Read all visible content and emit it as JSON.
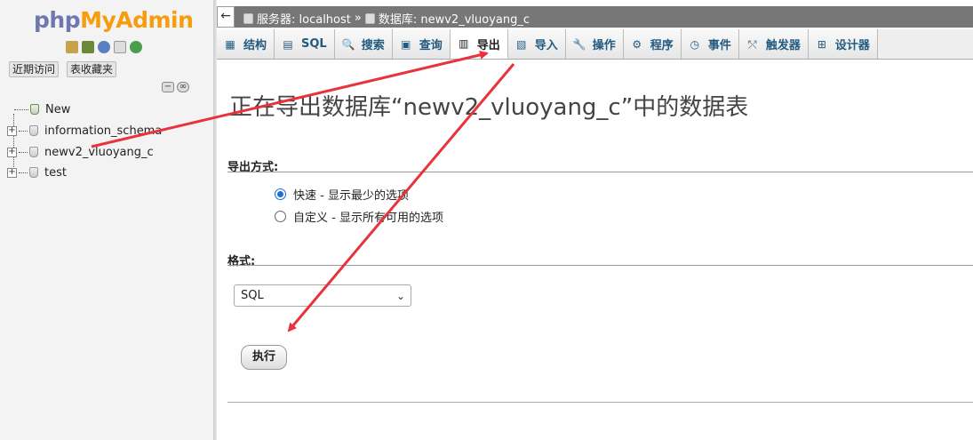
{
  "logo": {
    "part1": "php",
    "part2": "MyAdmin"
  },
  "nav": {
    "icons": [
      "home-icon",
      "exit-icon",
      "help-icon",
      "docs-icon",
      "reload-icon"
    ],
    "buttons": [
      "近期访问",
      "表收藏夹"
    ],
    "tree": [
      {
        "label": "New",
        "expandable": false
      },
      {
        "label": "information_schema",
        "expandable": true
      },
      {
        "label": "newv2_vluoyang_c",
        "expandable": true
      },
      {
        "label": "test",
        "expandable": true
      }
    ]
  },
  "breadcrumb": {
    "server_label": "服务器: localhost",
    "separator": "»",
    "db_label": "数据库: newv2_vluoyang_c"
  },
  "tabs": [
    {
      "label": "结构",
      "icon": "structure-icon",
      "glyph": "▦",
      "active": false
    },
    {
      "label": "SQL",
      "icon": "sql-icon",
      "glyph": "▤",
      "active": false
    },
    {
      "label": "搜索",
      "icon": "search-icon",
      "glyph": "🔍",
      "active": false
    },
    {
      "label": "查询",
      "icon": "query-icon",
      "glyph": "▣",
      "active": false
    },
    {
      "label": "导出",
      "icon": "export-icon",
      "glyph": "▥",
      "active": true
    },
    {
      "label": "导入",
      "icon": "import-icon",
      "glyph": "▧",
      "active": false
    },
    {
      "label": "操作",
      "icon": "wrench-icon",
      "glyph": "🔧",
      "active": false
    },
    {
      "label": "程序",
      "icon": "routines-icon",
      "glyph": "⚙",
      "active": false
    },
    {
      "label": "事件",
      "icon": "events-icon",
      "glyph": "◷",
      "active": false
    },
    {
      "label": "触发器",
      "icon": "triggers-icon",
      "glyph": "⤲",
      "active": false
    },
    {
      "label": "设计器",
      "icon": "designer-icon",
      "glyph": "⊞",
      "active": false
    }
  ],
  "main": {
    "title": "正在导出数据库“newv2_vluoyang_c”中的数据表",
    "method_title": "导出方式:",
    "method_options": [
      {
        "label": "快速 - 显示最少的选项",
        "checked": true
      },
      {
        "label": "自定义 - 显示所有可用的选项",
        "checked": false
      }
    ],
    "format_title": "格式:",
    "format_value": "SQL",
    "go_label": "执行"
  },
  "annotation_color": "#e8323c"
}
